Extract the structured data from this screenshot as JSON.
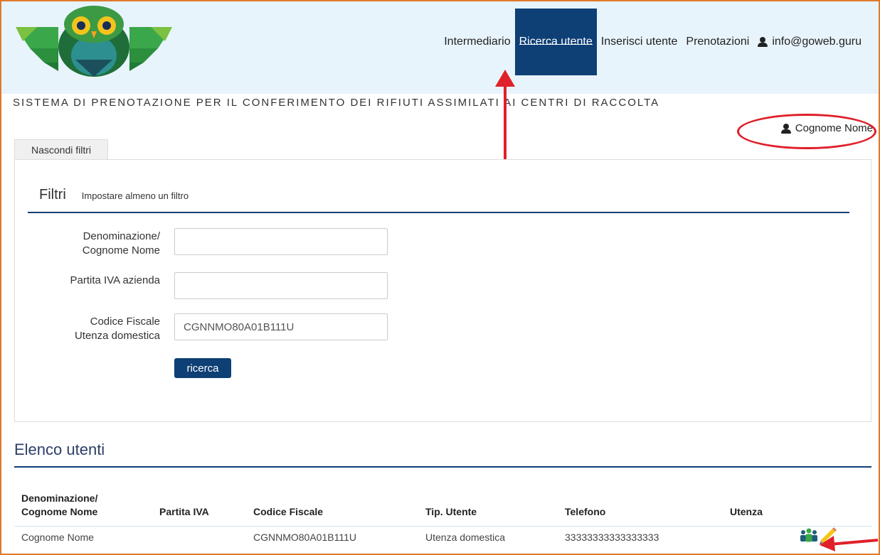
{
  "nav": {
    "items": [
      {
        "label": "Intermediario"
      },
      {
        "label": "Ricerca utente"
      },
      {
        "label": "Inserisci utente"
      },
      {
        "label": "Prenotazioni"
      }
    ],
    "account": "info@goweb.guru"
  },
  "system_title": "SISTEMA DI PRENOTAZIONE PER IL CONFERIMENTO DEI RIFIUTI ASSIMILATI AI CENTRI DI RACCOLTA",
  "user_name": "Cognome Nome",
  "hide_filters_label": "Nascondi filtri",
  "filters": {
    "title": "Filtri",
    "hint": "Impostare almeno un filtro",
    "fields": [
      {
        "label_line1": "Denominazione/",
        "label_line2": "Cognome Nome",
        "value": ""
      },
      {
        "label_line1": "Partita IVA azienda",
        "label_line2": "",
        "value": ""
      },
      {
        "label_line1": "Codice Fiscale",
        "label_line2": "Utenza domestica",
        "value": "CGNNMO80A01B111U"
      }
    ],
    "search_label": "ricerca"
  },
  "list": {
    "title": "Elenco utenti",
    "headers": {
      "denominazione_line1": "Denominazione/",
      "denominazione_line2": "Cognome Nome",
      "partita_iva": "Partita IVA",
      "codice_fiscale": "Codice Fiscale",
      "tip_utente": "Tip. Utente",
      "telefono": "Telefono",
      "utenza": "Utenza"
    },
    "rows": [
      {
        "denominazione": "Cognome Nome",
        "partita_iva": "",
        "codice_fiscale": "CGNNMO80A01B111U",
        "tip_utente": "Utenza domestica",
        "telefono": "33333333333333333"
      }
    ]
  },
  "colors": {
    "header_bg": "#e8f4fb",
    "accent": "#0e3f75",
    "annotation": "#e0202a",
    "frame": "#e07a2a"
  },
  "icons": [
    "owl-logo-icon",
    "user-icon",
    "users-group-icon",
    "pencil-icon"
  ]
}
